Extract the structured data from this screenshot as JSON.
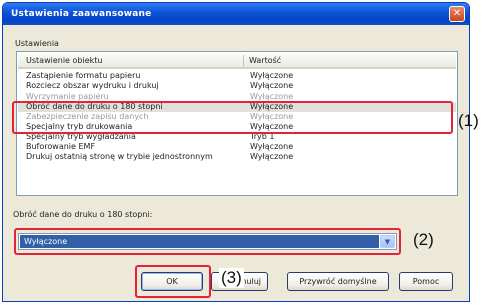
{
  "dialog": {
    "title": "Ustawienia zaawansowane",
    "close_glyph": "✕"
  },
  "settings": {
    "label": "Ustawienia",
    "columns": [
      "Ustawienie obiektu",
      "Wartość"
    ],
    "rows": [
      {
        "name": "Zastąpienie formatu papieru",
        "value": "Wyłączone",
        "state": "normal"
      },
      {
        "name": "Rozciecz obszar wydruku i drukuj",
        "value": "Wyłączone",
        "state": "normal"
      },
      {
        "name": "Wyrzymanie papieru",
        "value": "Wyłączone",
        "state": "dim"
      },
      {
        "name": "Obróć dane do druku o 180 stopni",
        "value": "Wyłączone",
        "state": "selected"
      },
      {
        "name": "Zabezpieczenie zapisu danych",
        "value": "Wyłączone",
        "state": "dim"
      },
      {
        "name": "Specjalny tryb drukowania",
        "value": "Wyłączone",
        "state": "normal"
      },
      {
        "name": "Specjalny tryb wygładzania",
        "value": "Tryb 1",
        "state": "normal"
      },
      {
        "name": "Buforowanie EMF",
        "value": "Wyłączone",
        "state": "normal"
      },
      {
        "name": "Drukuj ostatnią stronę w trybie jednostronnym",
        "value": "Wyłączone",
        "state": "normal"
      }
    ]
  },
  "field": {
    "label": "Obróć dane do druku o 180 stopni:",
    "value": "Wyłączone",
    "arrow_icon": "chevron-down-icon"
  },
  "buttons": {
    "ok": "OK",
    "cancel": "Anuluj",
    "defaults": "Przywróć domyślne",
    "help": "Pomoc"
  },
  "callouts": {
    "one": "(1)",
    "two": "(2)",
    "three": "(3)"
  },
  "colors": {
    "titlebar": "#0a52d8",
    "selection": "#335ea8",
    "highlight_box": "#e8213a",
    "dialog_bg": "#ece9d8"
  }
}
